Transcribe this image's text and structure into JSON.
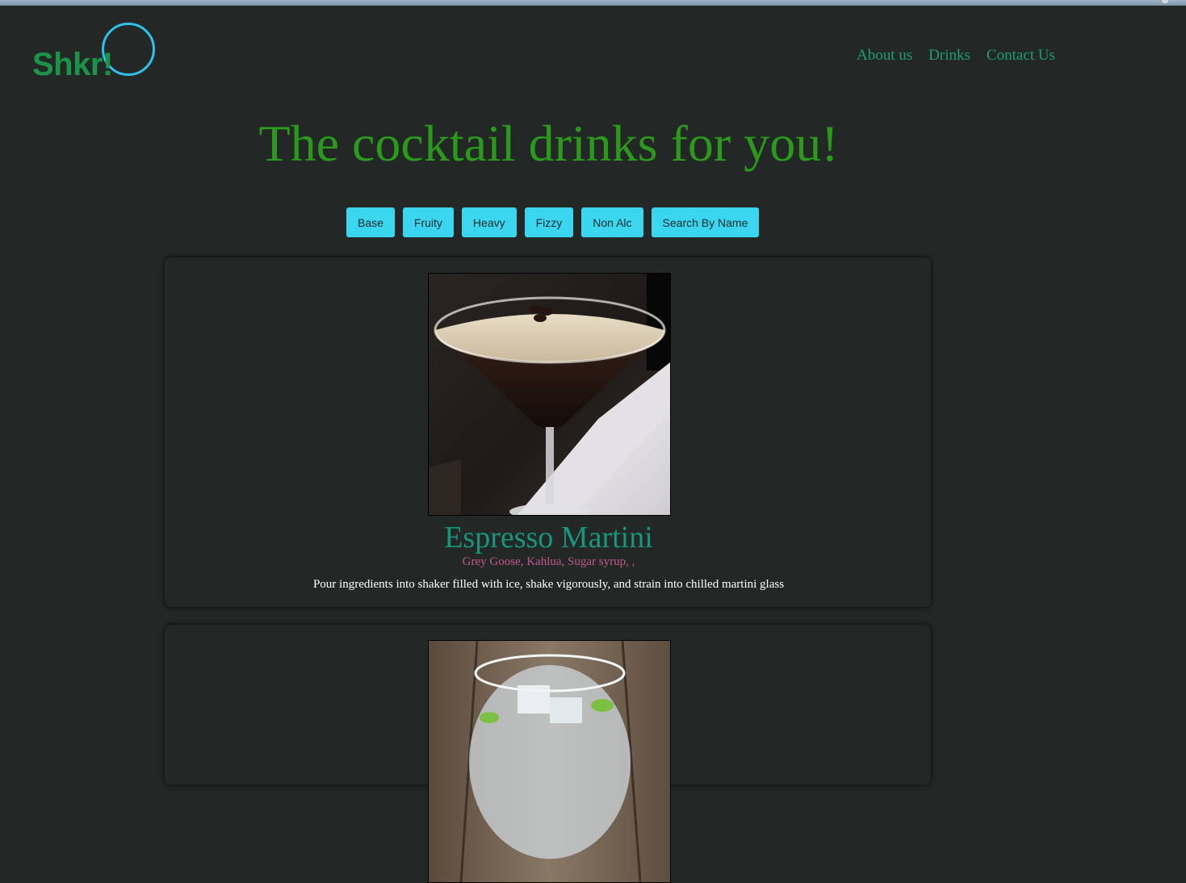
{
  "brand": {
    "logo_text": "Shkr!",
    "accent_green": "#1c9447",
    "ring_color": "#2fc1ec"
  },
  "nav": {
    "items": [
      "About us",
      "Drinks",
      "Contact Us"
    ]
  },
  "hero": {
    "title": "The cocktail drinks for you!"
  },
  "filters": {
    "buttons": [
      "Base",
      "Fruity",
      "Heavy",
      "Fizzy",
      "Non Alc",
      "Search By Name"
    ]
  },
  "drinks": [
    {
      "name": "Espresso Martini",
      "ingredients": "Grey Goose, Kahlua, Sugar syrup, ,",
      "method": "Pour ingredients into shaker filled with ice, shake vigorously, and strain into chilled martini glass",
      "image": "espresso-martini-photo"
    },
    {
      "image": "gin-and-tonic-photo"
    }
  ],
  "colors": {
    "background": "#232826",
    "filter_button": "#3ad6ef",
    "nav_link": "#1a9c78",
    "title": "#2b9a1c",
    "drink_name": "#18967c",
    "ingredients": "#c0568e"
  }
}
